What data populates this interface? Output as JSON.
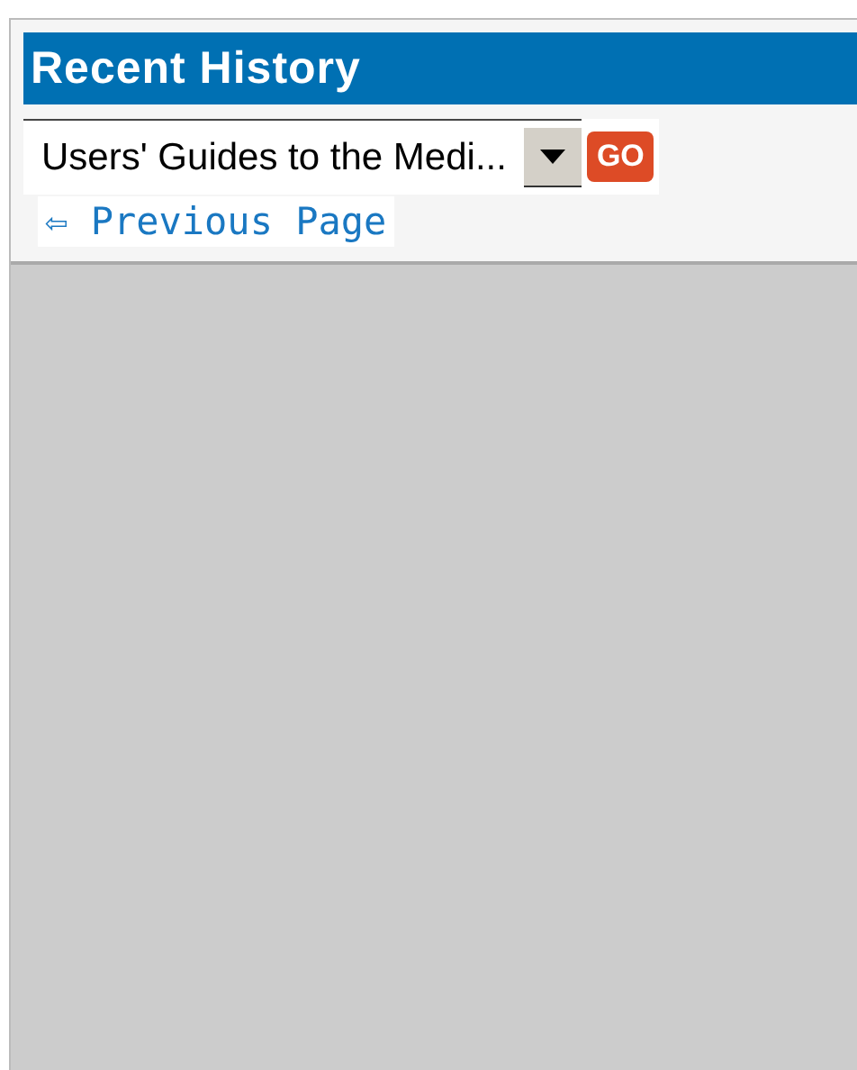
{
  "panel": {
    "title": "Recent History",
    "history_select": {
      "value": "Users' Guides to the Medi..."
    },
    "go_button": {
      "label": "GO"
    },
    "back_link": {
      "arrow": "⇦",
      "label": "Previous Page"
    }
  }
}
